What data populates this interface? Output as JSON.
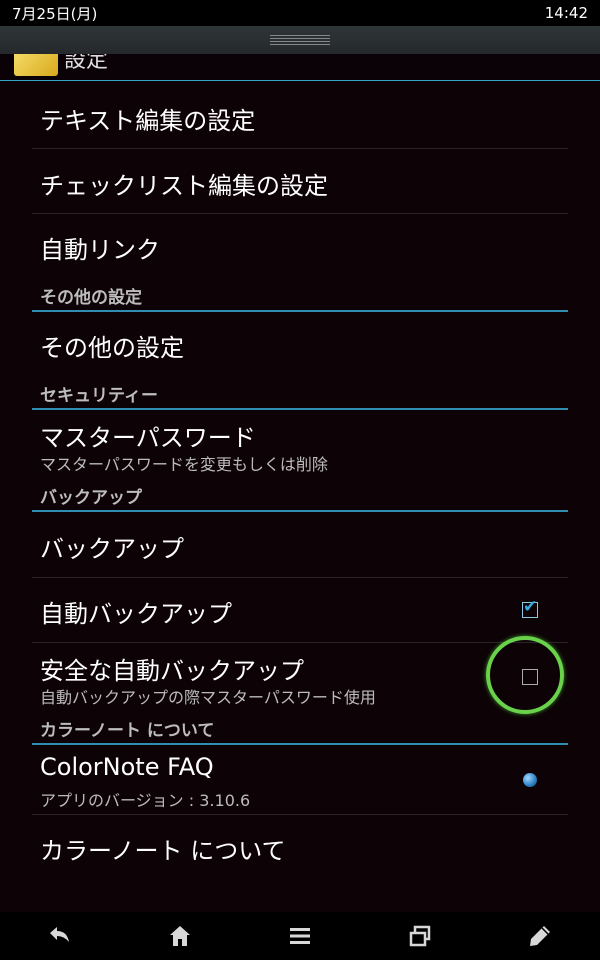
{
  "status_bar": {
    "date": "7月25日(月)",
    "time": "14:42"
  },
  "title_bar": {
    "title": "設定"
  },
  "items": {
    "text_edit": {
      "label": "テキスト編集の設定"
    },
    "checklist_edit": {
      "label": "チェックリスト編集の設定"
    },
    "auto_link": {
      "label": "自動リンク"
    },
    "section_other": {
      "label": "その他の設定"
    },
    "other_settings": {
      "label": "その他の設定"
    },
    "section_security": {
      "label": "セキュリティー"
    },
    "master_password": {
      "label": "マスターパスワード",
      "sub": "マスターパスワードを変更もしくは削除"
    },
    "section_backup": {
      "label": "バックアップ"
    },
    "backup": {
      "label": "バックアップ"
    },
    "auto_backup": {
      "label": "自動バックアップ",
      "checked": true
    },
    "secure_auto_backup": {
      "label": "安全な自動バックアップ",
      "sub": "自動バックアップの際マスターパスワード使用",
      "checked": false
    },
    "section_about": {
      "label": "カラーノート について"
    },
    "faq": {
      "label": "ColorNote FAQ",
      "sub": "アプリのバージョン : 3.10.6"
    },
    "about": {
      "label": "カラーノート について"
    }
  },
  "nav_bar": {
    "icons": [
      "back-icon",
      "home-icon",
      "menu-icon",
      "recent-apps-icon",
      "edit-icon"
    ]
  },
  "colors": {
    "accent": "#31a4c7",
    "check": "#39a7e0",
    "touch_ring": "#69d24a",
    "background": "#0d0307"
  }
}
